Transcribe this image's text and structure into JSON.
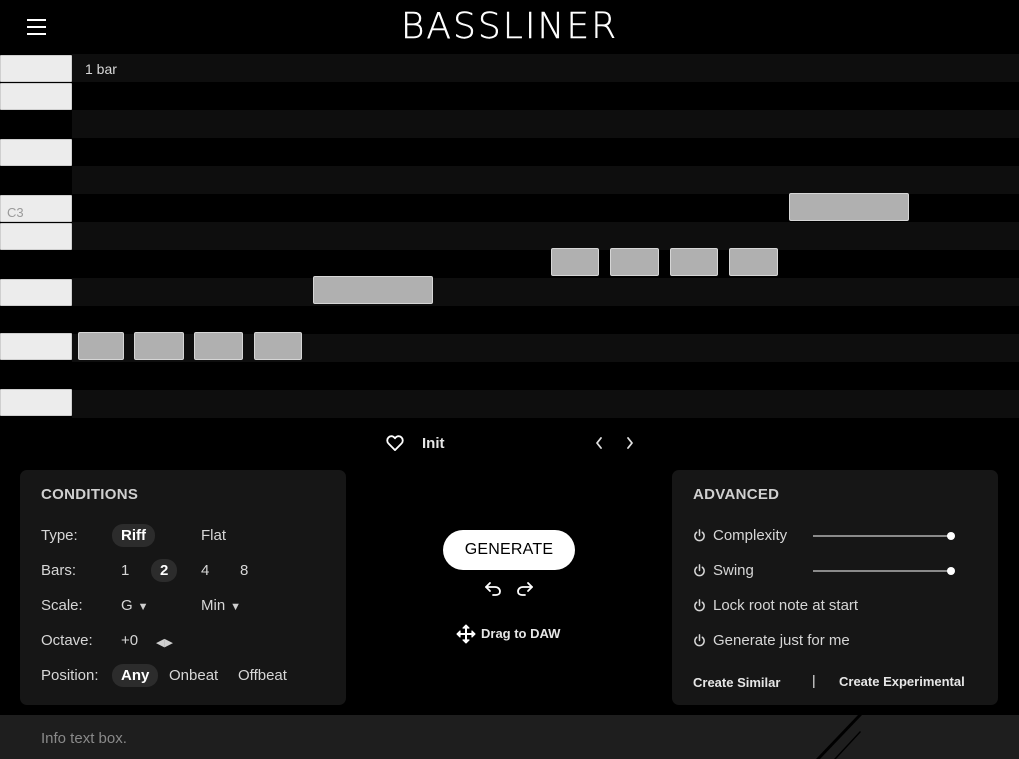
{
  "header": {
    "title": "BASSLINER",
    "menu_icon": "hamburger-icon"
  },
  "piano_roll": {
    "bar_label": "1 bar",
    "key_label": "C3"
  },
  "preset": {
    "name": "Init",
    "favorite_icon": "heart-icon",
    "prev_icon": "chevron-left-icon",
    "next_icon": "chevron-right-icon"
  },
  "conditions": {
    "title": "CONDITIONS",
    "type": {
      "label": "Type:",
      "options": [
        "Riff",
        "Flat"
      ],
      "selected": "Riff"
    },
    "bars": {
      "label": "Bars:",
      "options": [
        "1",
        "2",
        "4",
        "8"
      ],
      "selected": "2"
    },
    "scale": {
      "label": "Scale:",
      "key": "G",
      "mode": "Min"
    },
    "octave": {
      "label": "Octave:",
      "value": "+0"
    },
    "position": {
      "label": "Position:",
      "options": [
        "Any",
        "Onbeat",
        "Offbeat"
      ],
      "selected": "Any"
    }
  },
  "center": {
    "generate_label": "GENERATE",
    "undo_icon": "undo-icon",
    "redo_icon": "redo-icon",
    "drag_label": "Drag to DAW",
    "drag_icon": "move-icon"
  },
  "advanced": {
    "title": "ADVANCED",
    "complexity": {
      "label": "Complexity",
      "value": 1.0
    },
    "swing": {
      "label": "Swing",
      "value": 1.0
    },
    "lock_root_label": "Lock root note at start",
    "just_for_me_label": "Generate just for me",
    "create_similar": "Create Similar",
    "separator": "|",
    "create_experimental": "Create Experimental"
  },
  "info": {
    "text": "Info text box."
  },
  "colors": {
    "background": "#000000",
    "panel": "#161616",
    "note": "#b0b0b0",
    "info_bar": "#1e1e1e"
  }
}
